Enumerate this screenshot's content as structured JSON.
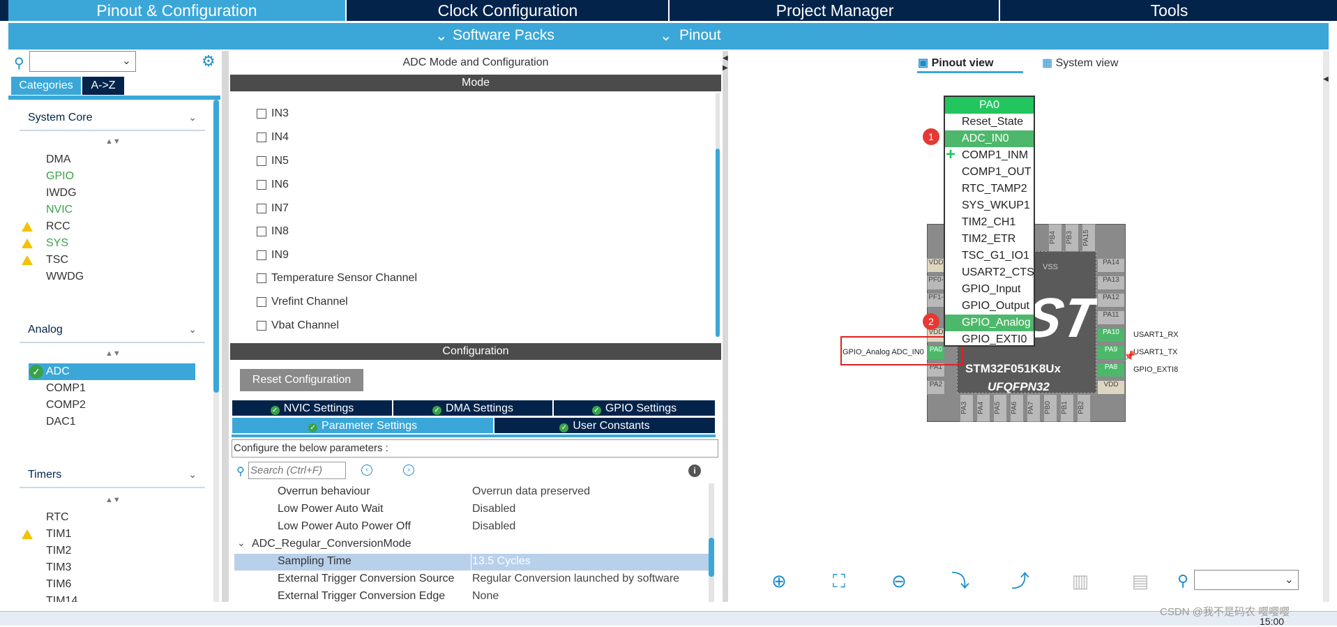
{
  "tabs": [
    {
      "label": "Pinout & Configuration",
      "active": true
    },
    {
      "label": "Clock Configuration",
      "active": false
    },
    {
      "label": "Project Manager",
      "active": false
    },
    {
      "label": "Tools",
      "active": false
    }
  ],
  "subbar": {
    "software_packs": "Software Packs",
    "pinout": "Pinout"
  },
  "left": {
    "categories_tab": "Categories",
    "az_tab": "A->Z",
    "system_core": {
      "title": "System Core",
      "items": [
        "DMA",
        "GPIO",
        "IWDG",
        "NVIC",
        "RCC",
        "SYS",
        "TSC",
        "WWDG"
      ]
    },
    "analog": {
      "title": "Analog",
      "items": [
        "ADC",
        "COMP1",
        "COMP2",
        "DAC1"
      ]
    },
    "timers": {
      "title": "Timers",
      "items": [
        "RTC",
        "TIM1",
        "TIM2",
        "TIM3",
        "TIM6",
        "TIM14"
      ]
    }
  },
  "middle": {
    "title": "ADC Mode and Configuration",
    "mode_label": "Mode",
    "channels": [
      "IN3",
      "IN4",
      "IN5",
      "IN6",
      "IN7",
      "IN8",
      "IN9",
      "Temperature Sensor Channel",
      "Vrefint Channel",
      "Vbat Channel"
    ],
    "configuration_label": "Configuration",
    "reset_button": "Reset Configuration",
    "tabs_row1": [
      "NVIC Settings",
      "DMA Settings",
      "GPIO Settings"
    ],
    "tabs_row2": [
      "Parameter Settings",
      "User Constants"
    ],
    "configure_text": "Configure the below parameters :",
    "search_placeholder": "Search (Ctrl+F)",
    "params": [
      {
        "key": "Overrun behaviour",
        "value": "Overrun data preserved"
      },
      {
        "key": "Low Power Auto Wait",
        "value": "Disabled"
      },
      {
        "key": "Low Power Auto Power Off",
        "value": "Disabled"
      },
      {
        "key": "ADC_Regular_ConversionMode",
        "value": ""
      },
      {
        "key": "Sampling Time",
        "value": "13.5 Cycles"
      },
      {
        "key": "External Trigger Conversion Source",
        "value": "Regular Conversion launched by software"
      },
      {
        "key": "External Trigger Conversion Edge",
        "value": "None"
      }
    ]
  },
  "right": {
    "pinout_view": "Pinout view",
    "system_view": "System view",
    "pin_header": "PA0",
    "pin_functions": [
      "Reset_State",
      "ADC_IN0",
      "COMP1_INM",
      "COMP1_OUT",
      "RTC_TAMP2",
      "SYS_WKUP1",
      "TIM2_CH1",
      "TIM2_ETR",
      "TSC_G1_IO1",
      "USART2_CTS",
      "GPIO_Input",
      "GPIO_Output",
      "GPIO_Analog",
      "GPIO_EXTI0"
    ],
    "badge1": "1",
    "badge2": "2",
    "pin_label": "GPIO_Analog ADC_IN0",
    "chip_name": "STM32F051K8Ux",
    "chip_package": "UFQFPN32",
    "right_labels": [
      "USART1_RX",
      "USART1_TX",
      "GPIO_EXTI8"
    ],
    "left_pins": [
      "VDD",
      "PF0-",
      "PF1-",
      "VDD",
      "PA0",
      "PA1",
      "PA2"
    ],
    "right_pins": [
      "PA14",
      "PA13",
      "PA12",
      "PA11",
      "PA10",
      "PA9",
      "PA8",
      "VDD"
    ],
    "top_pins": [
      "PB4",
      "PB3",
      "PA15"
    ],
    "bottom_pins": [
      "PA3",
      "PA4",
      "PA5",
      "PA6",
      "PA7",
      "PB0",
      "PB1",
      "PB2"
    ],
    "vss": "VSS"
  },
  "taskbar": {
    "time": "15:00",
    "watermark": "CSDN @我不是码农 嘤嘤嘤"
  },
  "colors": {
    "navy": "#03234b",
    "accent": "#3aa7d8",
    "green": "#3aa347",
    "selected_green": "#4db86b"
  }
}
